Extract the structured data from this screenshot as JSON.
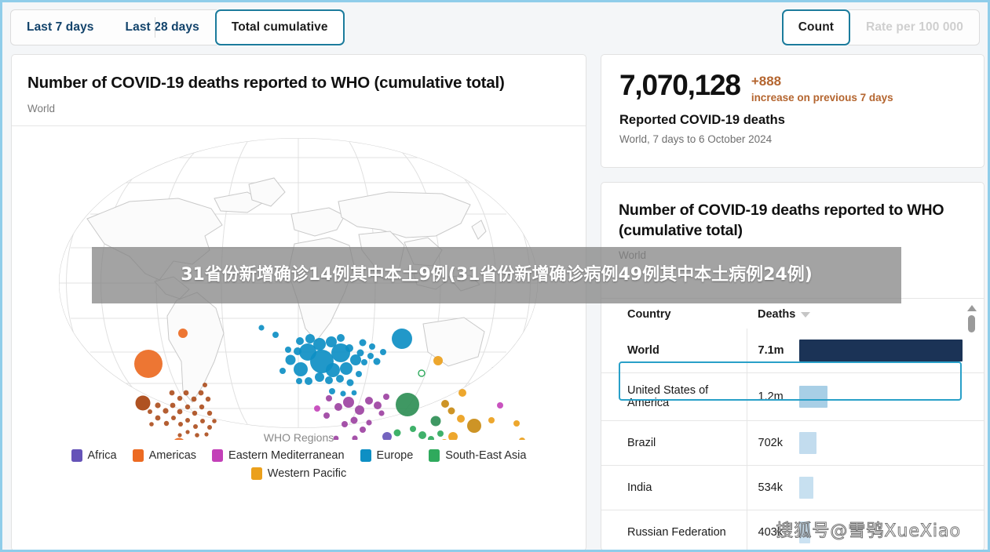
{
  "toolbar": {
    "period_tabs": [
      {
        "label": "Last 7 days",
        "active": false
      },
      {
        "label": "Last 28 days",
        "active": false
      },
      {
        "label": "Total cumulative",
        "active": true
      }
    ],
    "measure_tabs": [
      {
        "label": "Count",
        "active": true
      },
      {
        "label": "Rate per 100 000",
        "active": false
      }
    ]
  },
  "map_card": {
    "title": "Number of COVID-19 deaths reported to WHO (cumulative total)",
    "subtitle": "World",
    "legend_title": "WHO Regions",
    "legend": [
      {
        "label": "Africa",
        "color": "#6553b8"
      },
      {
        "label": "Americas",
        "color": "#ec6a22"
      },
      {
        "label": "Eastern Mediterranean",
        "color": "#c340b8"
      },
      {
        "label": "Europe",
        "color": "#0e8fc4"
      },
      {
        "label": "South-East Asia",
        "color": "#2faa5d"
      },
      {
        "label": "Western Pacific",
        "color": "#eba01c"
      }
    ]
  },
  "stat_card": {
    "value": "7,070,128",
    "delta_value": "+888",
    "delta_text": "increase on previous 7 days",
    "label": "Reported COVID-19 deaths",
    "scope": "World, 7 days to 6 October 2024",
    "delta_color": "#b4652f"
  },
  "table_card": {
    "title": "Number of COVID-19 deaths reported to WHO (cumulative total)",
    "subtitle": "World",
    "columns": [
      "Country",
      "Deaths"
    ],
    "sort_column": "Deaths",
    "sort_direction": "descending",
    "rows": [
      {
        "country": "World",
        "deaths": "7.1m",
        "bar_pct": 100,
        "selected": true,
        "bar_color": "#1b3356"
      },
      {
        "country": "United States of America",
        "deaths": "1.2m",
        "bar_pct": 17,
        "selected": false,
        "bar_color": "#a8cfe6"
      },
      {
        "country": "Brazil",
        "deaths": "702k",
        "bar_pct": 10,
        "selected": false,
        "bar_color": "#c2dcee"
      },
      {
        "country": "India",
        "deaths": "534k",
        "bar_pct": 7.5,
        "selected": false,
        "bar_color": "#c7e0f0"
      },
      {
        "country": "Russian Federation",
        "deaths": "403k",
        "bar_pct": 5.7,
        "selected": false,
        "bar_color": "#cbe2f2"
      }
    ]
  },
  "chart_data": {
    "type": "bar",
    "title": "Number of COVID-19 deaths reported to WHO (cumulative total)",
    "xlabel": "Deaths",
    "ylabel": "Country",
    "categories": [
      "World",
      "United States of America",
      "Brazil",
      "India",
      "Russian Federation"
    ],
    "values": [
      7100000,
      1200000,
      702000,
      534000,
      403000
    ],
    "value_labels": [
      "7.1m",
      "1.2m",
      "702k",
      "534k",
      "403k"
    ],
    "legend": null,
    "grid": false
  },
  "overlay": {
    "banner_text": "31省份新增确诊14例其中本土9例(31省份新增确诊病例49例其中本土病例24例)",
    "watermark": "搜狐号@雪鸮XueXiao"
  }
}
